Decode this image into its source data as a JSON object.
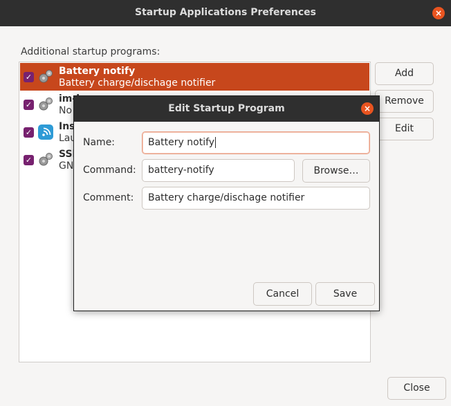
{
  "window": {
    "title": "Startup Applications Preferences",
    "close_glyph": "×",
    "section_label": "Additional startup programs:",
    "buttons": {
      "add": "Add",
      "remove": "Remove",
      "edit": "Edit",
      "close": "Close"
    }
  },
  "programs": [
    {
      "name": "Battery notify",
      "description": "Battery charge/dischage notifier",
      "checked": true,
      "selected": true,
      "icon": "gears-icon"
    },
    {
      "name": "im-l",
      "description": "No",
      "checked": true,
      "selected": false,
      "icon": "gears-icon"
    },
    {
      "name": "Ins",
      "description": "Lau",
      "checked": true,
      "selected": false,
      "icon": "wifi-app-icon"
    },
    {
      "name": "SSH",
      "description": "GN",
      "checked": true,
      "selected": false,
      "icon": "gears-icon"
    }
  ],
  "dialog": {
    "title": "Edit Startup Program",
    "close_glyph": "×",
    "name_label": "Name:",
    "name_value": "Battery notify",
    "command_label": "Command:",
    "command_value": "battery-notify",
    "browse_label": "Browse…",
    "comment_label": "Comment:",
    "comment_value": "Battery charge/dischage notifier",
    "cancel_label": "Cancel",
    "save_label": "Save"
  },
  "colors": {
    "accent": "#e95420",
    "selection": "#c7471c",
    "checkbox": "#77216f",
    "titlebar": "#2f2f2f"
  }
}
